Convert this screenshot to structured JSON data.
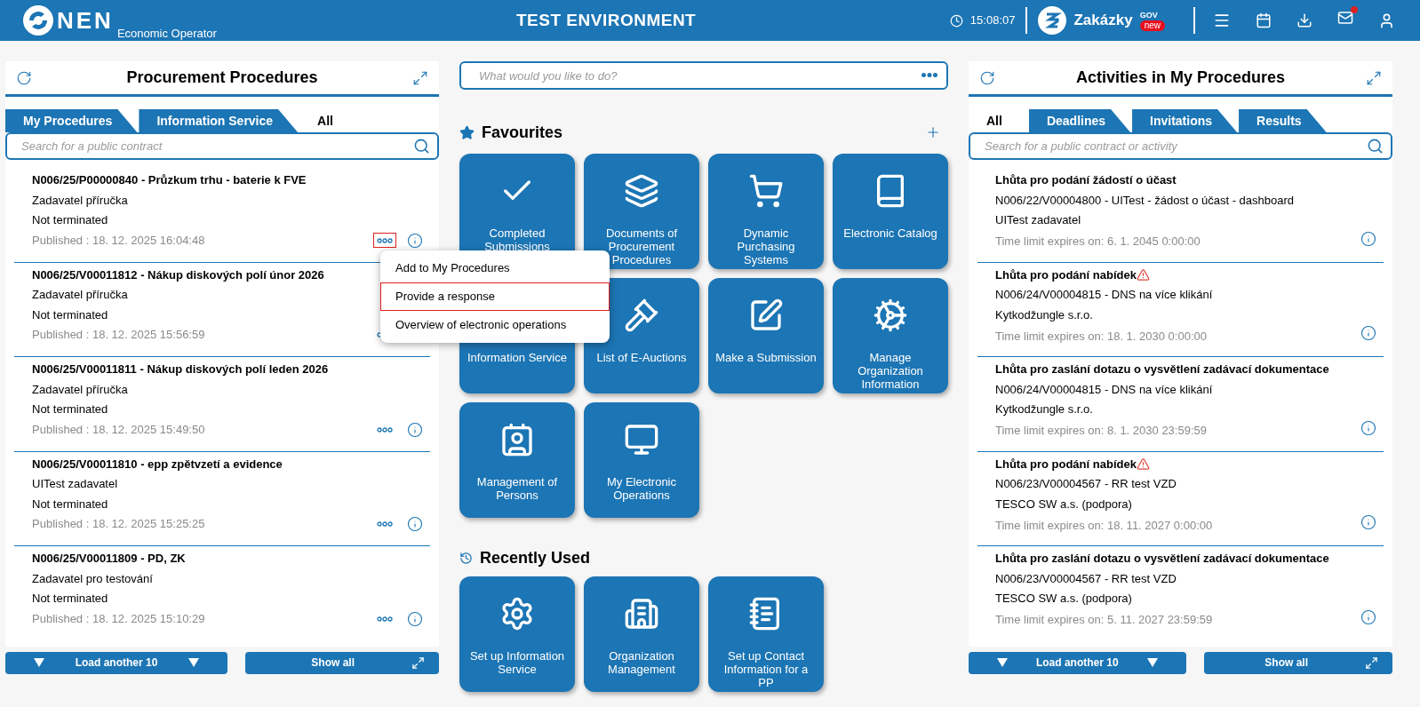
{
  "header": {
    "logo_text": "NEN",
    "subtitle": "Economic Operator",
    "environment": "TEST ENVIRONMENT",
    "time": "15:08:07",
    "brand": "Zakázky",
    "brand_sup": "GOV",
    "brand_badge": "new",
    "mail_unread": true
  },
  "procedures_panel": {
    "title": "Procurement Procedures",
    "tabs": [
      {
        "label": "My Procedures",
        "selected": false
      },
      {
        "label": "Information Service",
        "selected": false
      },
      {
        "label": "All",
        "selected": true
      }
    ],
    "search": {
      "placeholder": "Search for a public contract"
    },
    "items": [
      {
        "title": "N006/25/P00000840 - Průzkum trhu - baterie k FVE",
        "org": "Zadavatel příručka",
        "status": "Not terminated",
        "published": "Published : 18. 12. 2025 16:04:48",
        "menu_open": true
      },
      {
        "title": "N006/25/V00011812 - Nákup diskových polí únor 2026",
        "org": "Zadavatel příručka",
        "status": "Not terminated",
        "published": "Published : 18. 12. 2025 15:56:59",
        "menu_open": false
      },
      {
        "title": "N006/25/V00011811 - Nákup diskových polí leden 2026",
        "org": "Zadavatel příručka",
        "status": "Not terminated",
        "published": "Published : 18. 12. 2025 15:49:50",
        "menu_open": false
      },
      {
        "title": "N006/25/V00011810 - epp zpětvzetí a evidence",
        "org": "UITest zadavatel",
        "status": "Not terminated",
        "published": "Published : 18. 12. 2025 15:25:25",
        "menu_open": false
      },
      {
        "title": "N006/25/V00011809 - PD, ZK",
        "org": "Zadavatel pro testování",
        "status": "Not terminated",
        "published": "Published : 18. 12. 2025 15:10:29",
        "menu_open": false
      }
    ],
    "load_button": "Load another 10",
    "show_all_button": "Show all"
  },
  "context_menu": {
    "items": [
      {
        "label": "Add to My Procedures",
        "highlighted": false
      },
      {
        "label": "Provide a response",
        "highlighted": true
      },
      {
        "label": "Overview of electronic operations",
        "highlighted": false
      }
    ]
  },
  "command_search": {
    "placeholder": "What would you like to do?"
  },
  "favourites": {
    "title": "Favourites",
    "tiles": [
      {
        "label": "Completed Submissions"
      },
      {
        "label": "Documents of Procurement Procedures"
      },
      {
        "label": "Dynamic Purchasing Systems"
      },
      {
        "label": "Electronic Catalog"
      },
      {
        "label": "Information Service"
      },
      {
        "label": "List of E-Auctions"
      },
      {
        "label": "Make a Submission"
      },
      {
        "label": "Manage Organization Information"
      },
      {
        "label": "Management of Persons"
      },
      {
        "label": "My Electronic Operations"
      }
    ]
  },
  "recently_used": {
    "title": "Recently Used",
    "tiles": [
      {
        "label": "Set up Information Service"
      },
      {
        "label": "Organization Management"
      },
      {
        "label": "Set up Contact Information for a PP"
      }
    ]
  },
  "activities_panel": {
    "title": "Activities in My Procedures",
    "tabs": [
      {
        "label": "All",
        "selected": true
      },
      {
        "label": "Deadlines",
        "selected": false
      },
      {
        "label": "Invitations",
        "selected": false
      },
      {
        "label": "Results",
        "selected": false
      }
    ],
    "search": {
      "placeholder": "Search for a public contract or activity"
    },
    "items": [
      {
        "title": "Lhůta pro podání žádostí o účast",
        "warning": false,
        "procedure": "N006/22/V00004800 - UITest - žádost o účast - dashboard",
        "org": "UITest zadavatel",
        "deadline": "Time limit expires on: 6. 1. 2045 0:00:00"
      },
      {
        "title": "Lhůta pro podání nabídek",
        "warning": true,
        "procedure": "N006/24/V00004815 - DNS na více klikání",
        "org": "Kytkodžungle s.r.o.",
        "deadline": "Time limit expires on: 18. 1. 2030 0:00:00"
      },
      {
        "title": "Lhůta pro zaslání dotazu o vysvětlení zadávací dokumentace",
        "warning": false,
        "procedure": "N006/24/V00004815 - DNS na více klikání",
        "org": "Kytkodžungle s.r.o.",
        "deadline": "Time limit expires on: 8. 1. 2030 23:59:59"
      },
      {
        "title": "Lhůta pro podání nabídek",
        "warning": true,
        "procedure": "N006/23/V00004567 - RR test VZD",
        "org": "TESCO SW a.s. (podpora)",
        "deadline": "Time limit expires on: 18. 11. 2027 0:00:00"
      },
      {
        "title": "Lhůta pro zaslání dotazu o vysvětlení zadávací dokumentace",
        "warning": false,
        "procedure": "N006/23/V00004567 - RR test VZD",
        "org": "TESCO SW a.s. (podpora)",
        "deadline": "Time limit expires on: 5. 11. 2027 23:59:59"
      }
    ],
    "load_button": "Load another 10",
    "show_all_button": "Show all"
  }
}
